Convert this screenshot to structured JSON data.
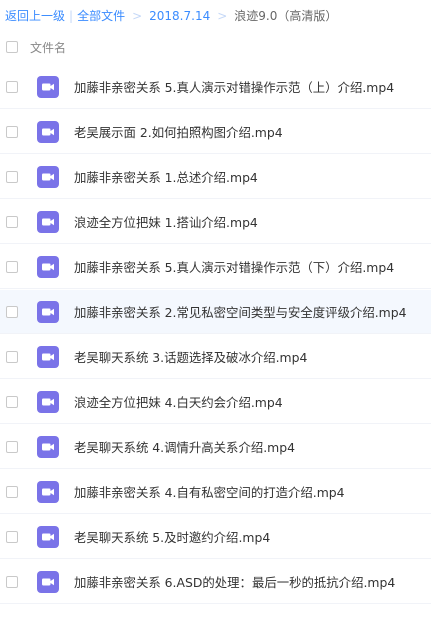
{
  "breadcrumb": {
    "back": "返回上一级",
    "separator": "|",
    "all_files": "全部文件",
    "arrow": ">",
    "folder": "2018.7.14",
    "current": "浪迹9.0（高清版）"
  },
  "header": {
    "column_name": "文件名"
  },
  "colors": {
    "link": "#3b8cff",
    "video_icon": "#7a73e8",
    "row_highlight": "#f4f8fe"
  },
  "files": [
    {
      "name": "加藤非亲密关系 5.真人演示对错操作示范（上）介绍.mp4",
      "icon": "video-file-icon"
    },
    {
      "name": "老吴展示面 2.如何拍照构图介绍.mp4",
      "icon": "video-file-icon"
    },
    {
      "name": "加藤非亲密关系 1.总述介绍.mp4",
      "icon": "video-file-icon"
    },
    {
      "name": "浪迹全方位把妹 1.搭讪介绍.mp4",
      "icon": "video-file-icon"
    },
    {
      "name": "加藤非亲密关系 5.真人演示对错操作示范（下）介绍.mp4",
      "icon": "video-file-icon"
    },
    {
      "name": "加藤非亲密关系 2.常见私密空间类型与安全度评级介绍.mp4",
      "icon": "video-file-icon"
    },
    {
      "name": "老吴聊天系统 3.话题选择及破冰介绍.mp4",
      "icon": "video-file-icon"
    },
    {
      "name": "浪迹全方位把妹 4.白天约会介绍.mp4",
      "icon": "video-file-icon"
    },
    {
      "name": "老吴聊天系统 4.调情升高关系介绍.mp4",
      "icon": "video-file-icon"
    },
    {
      "name": "加藤非亲密关系 4.自有私密空间的打造介绍.mp4",
      "icon": "video-file-icon"
    },
    {
      "name": "老吴聊天系统 5.及时邀约介绍.mp4",
      "icon": "video-file-icon"
    },
    {
      "name": "加藤非亲密关系 6.ASD的处理：最后一秒的抵抗介绍.mp4",
      "icon": "video-file-icon"
    }
  ]
}
